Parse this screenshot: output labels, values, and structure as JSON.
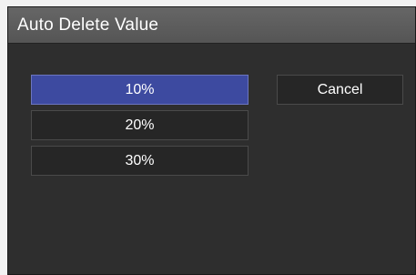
{
  "dialog": {
    "title": "Auto Delete Value",
    "options": [
      {
        "label": "10%",
        "selected": true
      },
      {
        "label": "20%",
        "selected": false
      },
      {
        "label": "30%",
        "selected": false
      }
    ],
    "cancel_label": "Cancel"
  },
  "colors": {
    "selected_option": "#3d4aa0",
    "panel_background": "#2e2e2e",
    "titlebar": "#5f5f5f"
  }
}
